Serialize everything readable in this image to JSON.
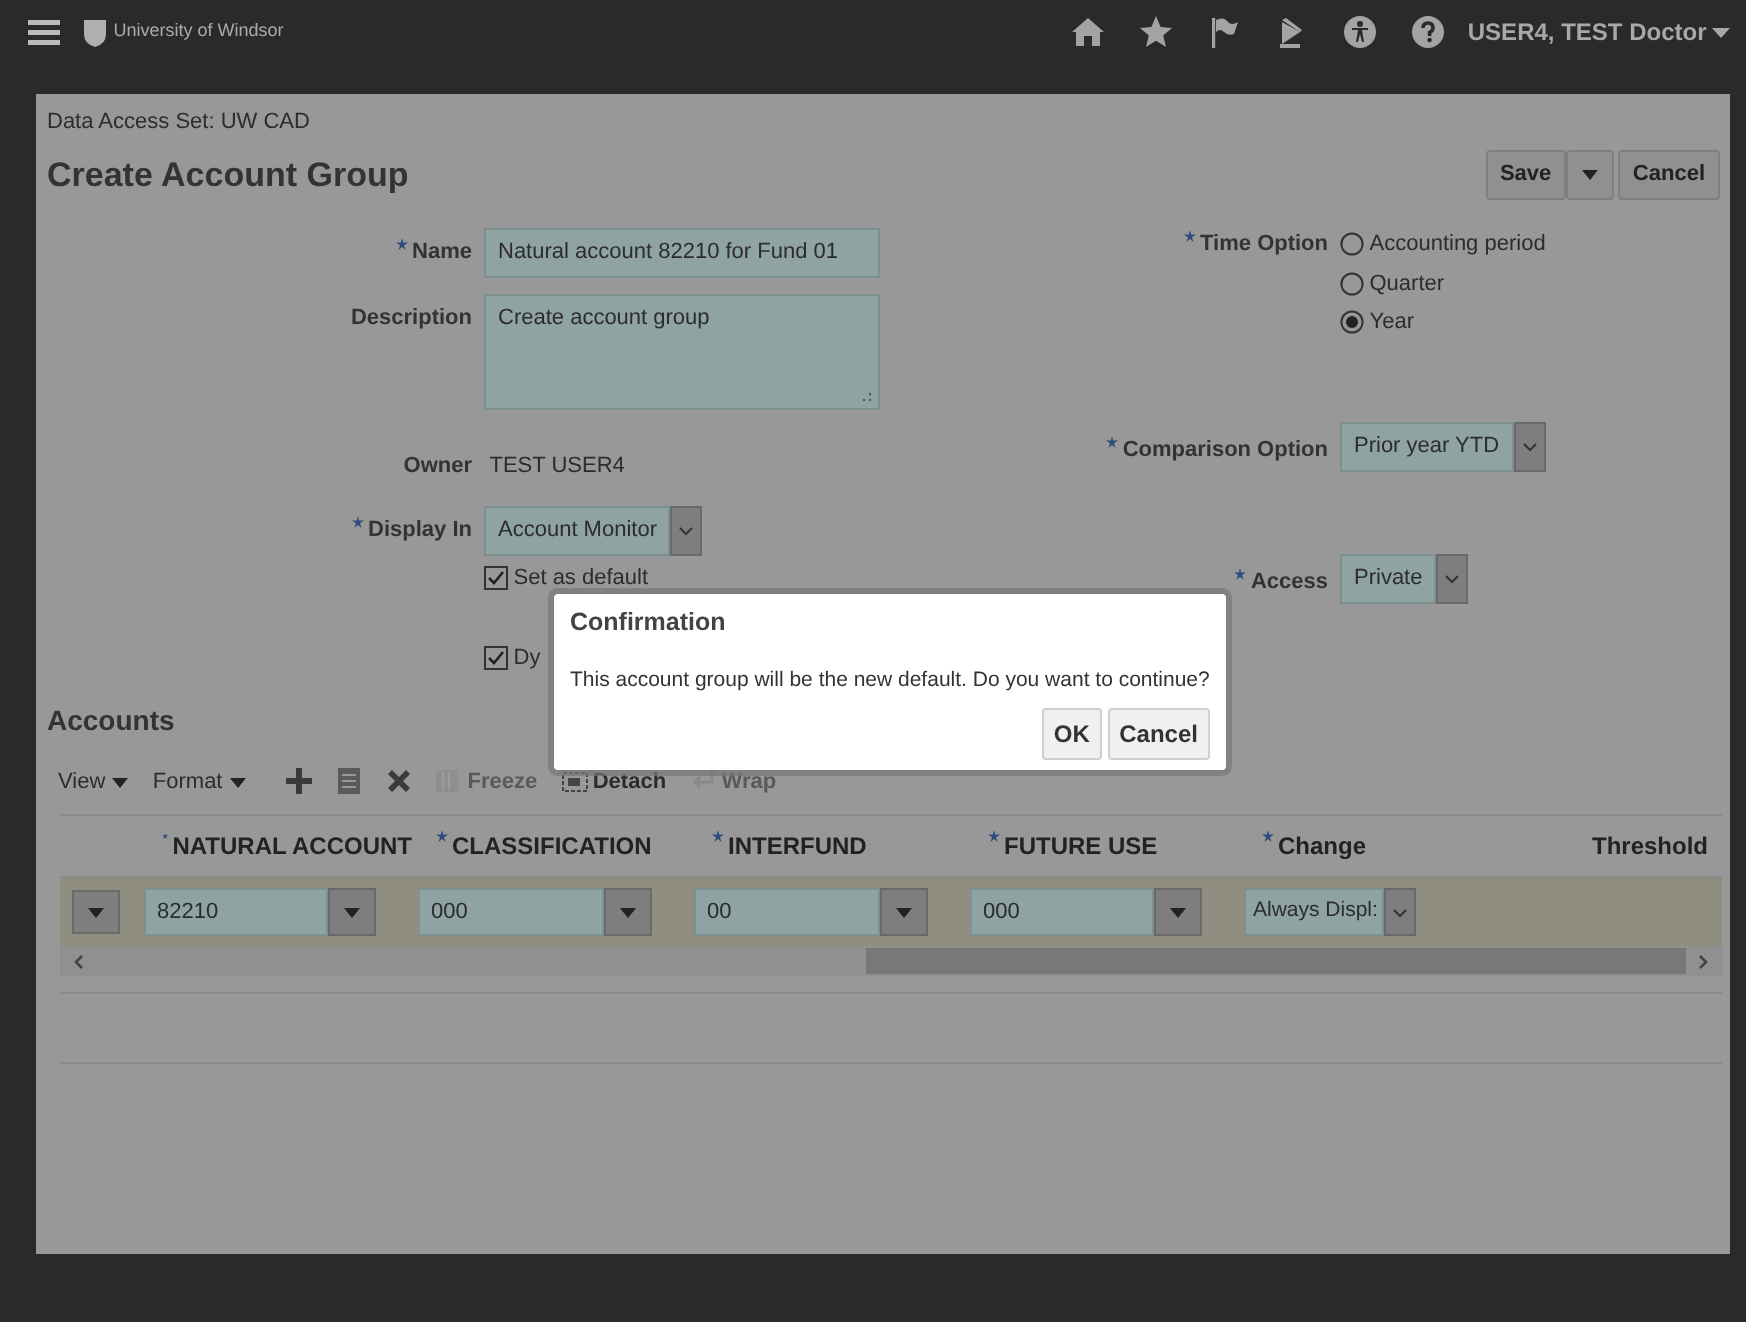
{
  "header": {
    "logo_text": "University of Windsor",
    "user": "USER4, TEST Doctor"
  },
  "page": {
    "data_access": "Data Access Set: UW CAD",
    "title": "Create Account Group",
    "buttons": [
      "Save",
      "Cancel"
    ]
  },
  "form_left": {
    "name": {
      "label": "Name",
      "required": true,
      "value": "Natural account 82210 for Fund 01"
    },
    "description": {
      "label": "Description",
      "value": "Create account group"
    },
    "owner": {
      "label": "Owner",
      "value": "TEST USER4"
    },
    "display_in": {
      "label": "Display In",
      "required": true,
      "value": "Account Monitor"
    },
    "checkboxes": [
      {
        "label": "Set as default",
        "checked": true
      },
      {
        "label": "Dy",
        "checked": true
      }
    ]
  },
  "form_right": {
    "time_option": {
      "label": "Time Option",
      "required": true,
      "options": [
        {
          "label": "Accounting period",
          "selected": false
        },
        {
          "label": "Quarter",
          "selected": false
        },
        {
          "label": "Year",
          "selected": true
        }
      ]
    },
    "comparison": {
      "label": "Comparison Option",
      "required": true,
      "value": "Prior year YTD"
    },
    "access": {
      "label": "Access",
      "required": true,
      "value": "Private"
    }
  },
  "accounts": {
    "title": "Accounts",
    "toolbar": [
      {
        "kind": "menu",
        "label": "View"
      },
      {
        "kind": "add"
      },
      {
        "kind": "list"
      },
      {
        "kind": "delete"
      },
      {
        "kind": "freeze",
        "label": "Freeze",
        "disabled": true
      },
      {
        "kind": "detach",
        "label": "Detach",
        "disabled": false
      },
      {
        "kind": "wrap",
        "label": "Wrap",
        "disabled": true
      }
    ],
    "format_menu": "Format",
    "columns": [
      {
        "label": "NATURAL ACCOUNT",
        "required": true
      },
      {
        "label": "CLASSIFICATION",
        "required": true
      },
      {
        "label": "INTERFUND",
        "required": true
      },
      {
        "label": "FUTURE USE",
        "required": true
      },
      {
        "label": "Change",
        "required": true
      },
      {
        "label": "Threshold"
      }
    ],
    "rows": [
      {
        "selected": true,
        "cells": [
          "82210",
          "000",
          "00",
          "000",
          "Always Displ:"
        ]
      }
    ]
  },
  "dialog": {
    "title": "Confirmation",
    "message": "This account group will be the new default. Do you want to continue?",
    "buttons": [
      "OK",
      "Cancel"
    ]
  }
}
